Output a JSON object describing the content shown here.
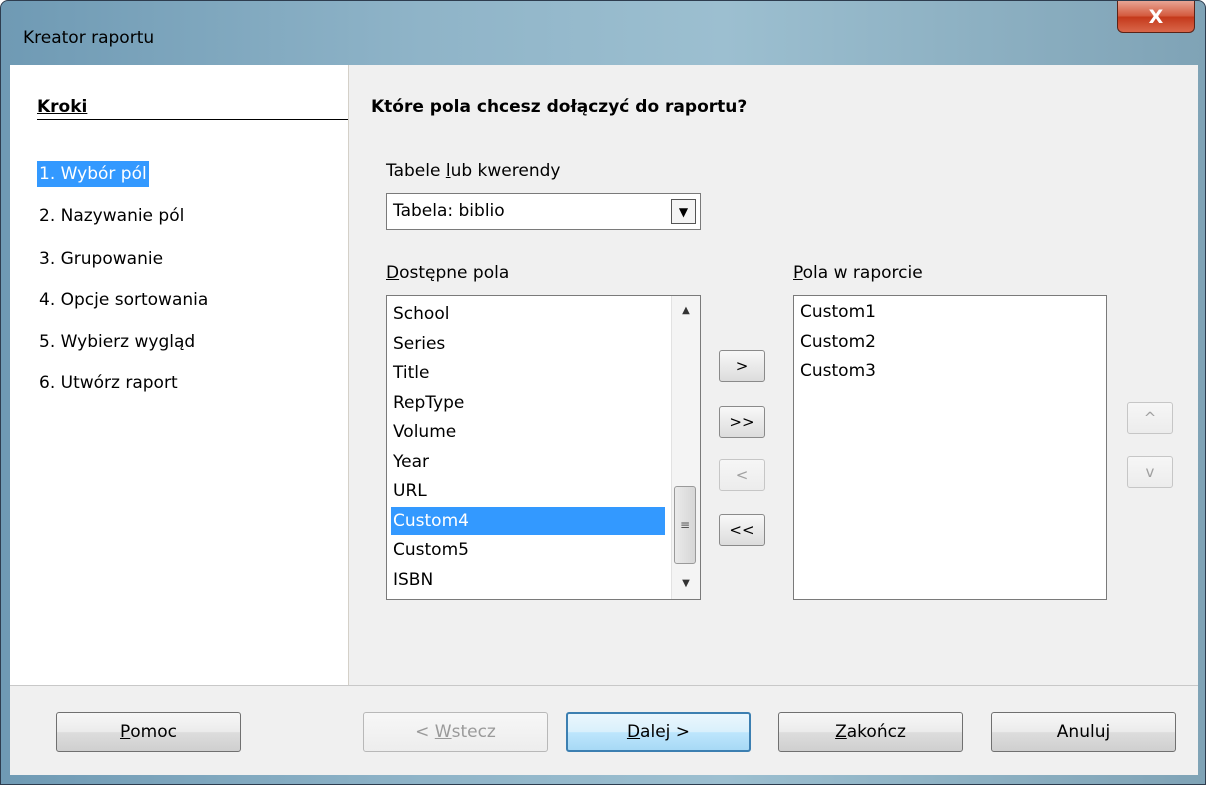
{
  "window": {
    "title": "Kreator raportu",
    "close_glyph": "X"
  },
  "steps": {
    "title": "Kroki",
    "items": [
      {
        "label": "1. Wybór pól",
        "selected": true
      },
      {
        "label": "2. Nazywanie pól",
        "selected": false
      },
      {
        "label": "3. Grupowanie",
        "selected": false
      },
      {
        "label": "4. Opcje sortowania",
        "selected": false
      },
      {
        "label": "5. Wybierz wygląd",
        "selected": false
      },
      {
        "label": "6. Utwórz raport",
        "selected": false
      }
    ]
  },
  "main": {
    "question": "Które pola chcesz dołączyć do raportu?",
    "tables_label_pre": "Tabele ",
    "tables_label_key": "l",
    "tables_label_post": "ub kwerendy",
    "tables_value": "Tabela: biblio",
    "available_label_key": "D",
    "available_label_post": "ostępne pola",
    "available_fields": [
      "School",
      "Series",
      "Title",
      "RepType",
      "Volume",
      "Year",
      "URL",
      "Custom4",
      "Custom5",
      "ISBN"
    ],
    "available_selected": "Custom4",
    "report_label_key": "P",
    "report_label_post": "ola w raporcie",
    "report_fields": [
      "Custom1",
      "Custom2",
      "Custom3"
    ],
    "move": {
      "add_one": ">",
      "add_all": ">>",
      "remove_one": "<",
      "remove_all": "<<"
    },
    "order": {
      "up": "^",
      "down": "v"
    }
  },
  "buttons": {
    "help_key": "P",
    "help_rest": "omoc",
    "back_pre": "< ",
    "back_key": "W",
    "back_rest": "stecz",
    "next_key": "D",
    "next_rest": "alej >",
    "finish_key": "Z",
    "finish_rest": "akończ",
    "cancel": "Anuluj"
  },
  "colors": {
    "selection": "#3399ff",
    "close_button": "#c4391b",
    "title_bar": "#8fb4c8"
  }
}
